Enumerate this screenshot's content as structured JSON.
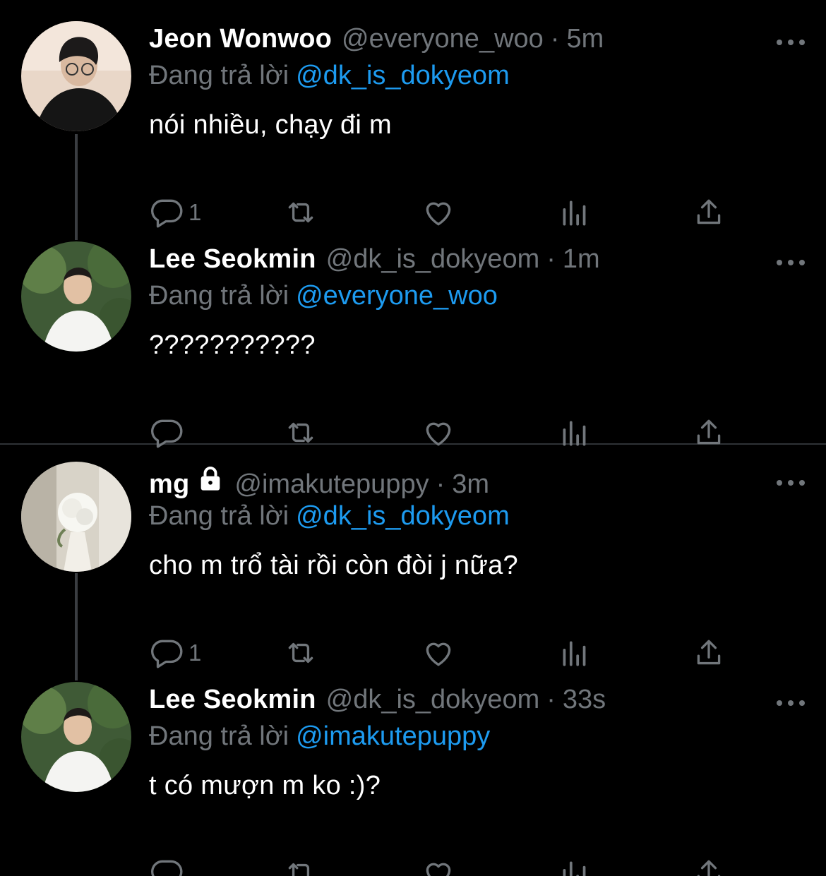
{
  "colors": {
    "background": "#000000",
    "primary_text": "#ffffff",
    "secondary_text": "#71767b",
    "mention": "#1d9bf0",
    "thread_line": "#3a3d41"
  },
  "tweets": [
    {
      "name": "Jeon Wonwoo",
      "handle": "@everyone_woo",
      "separator": "·",
      "time": "5m",
      "replying_label": "Đang trả lời",
      "replying_to": "@dk_is_dokyeom",
      "text": "nói nhiều, chạy đi m",
      "reply_count": "1",
      "locked": false
    },
    {
      "name": "Lee Seokmin",
      "handle": "@dk_is_dokyeom",
      "separator": "·",
      "time": "1m",
      "replying_label": "Đang trả lời",
      "replying_to": "@everyone_woo",
      "text": "???????????",
      "reply_count": "",
      "locked": false
    },
    {
      "name": "mg",
      "handle": "@imakutepuppy",
      "separator": "·",
      "time": "3m",
      "replying_label": "Đang trả lời",
      "replying_to": "@dk_is_dokyeom",
      "text": "cho m trổ tài rồi còn đòi j nữa?",
      "reply_count": "1",
      "locked": true
    },
    {
      "name": "Lee Seokmin",
      "handle": "@dk_is_dokyeom",
      "separator": "·",
      "time": "33s",
      "replying_label": "Đang trả lời",
      "replying_to": "@imakutepuppy",
      "text": "t có mượn m ko :)?",
      "reply_count": "",
      "locked": false
    }
  ],
  "icons": {
    "reply": "reply-icon",
    "retweet": "retweet-icon",
    "like": "heart-icon",
    "views": "views-icon",
    "share": "share-icon",
    "more": "more-icon",
    "lock": "lock-icon"
  }
}
